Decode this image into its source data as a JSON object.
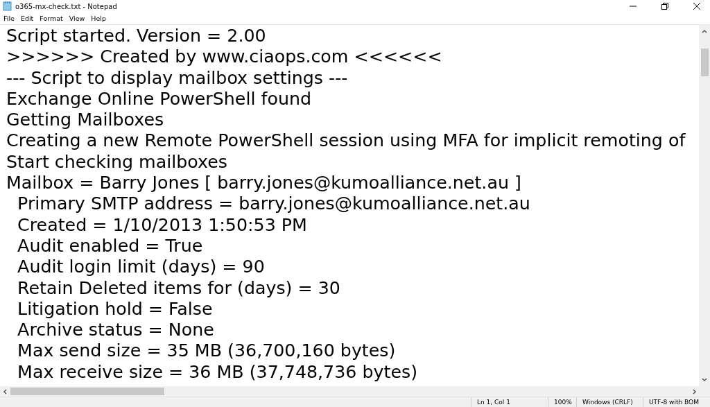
{
  "window": {
    "title": "o365-mx-check.txt - Notepad"
  },
  "menu": [
    "File",
    "Edit",
    "Format",
    "View",
    "Help"
  ],
  "lines": [
    "Script started. Version = 2.00",
    ">>>>>> Created by www.ciaops.com <<<<<<",
    "--- Script to display mailbox settings ---",
    "Exchange Online PowerShell found",
    "Getting Mailboxes",
    "Creating a new Remote PowerShell session using MFA for implicit remoting of",
    "Start checking mailboxes",
    "Mailbox = Barry Jones [ barry.jones@kumoalliance.net.au ]",
    "  Primary SMTP address = barry.jones@kumoalliance.net.au",
    "  Created = 1/10/2013 1:50:53 PM",
    "  Audit enabled = True",
    "  Audit login limit (days) = 90",
    "  Retain Deleted items for (days) = 30",
    "  Litigation hold = False",
    "  Archive status = None",
    "  Max send size = 35 MB (36,700,160 bytes)",
    "  Max receive size = 36 MB (37,748,736 bytes)"
  ],
  "status_bar": [
    "Ln 1, Col 1",
    "100%",
    "Windows (CRLF)",
    "UTF-8 with BOM"
  ]
}
